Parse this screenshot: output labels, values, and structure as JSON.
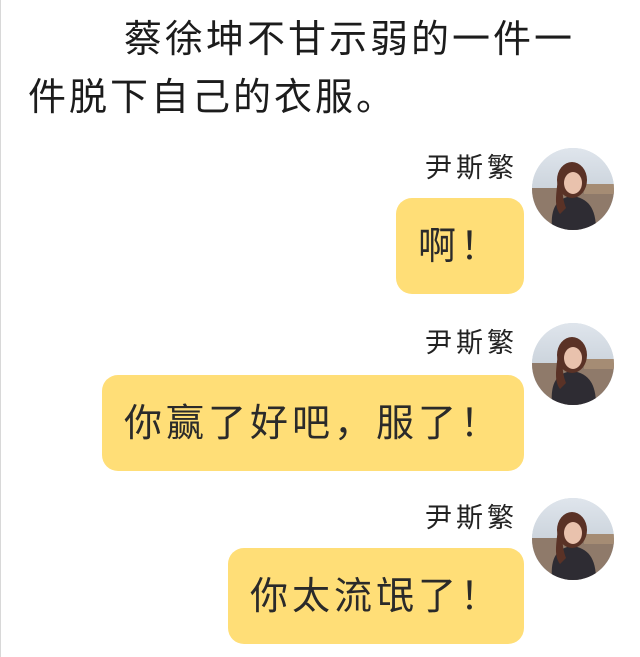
{
  "narration": "蔡徐坤不甘示弱的一件一件脱下自己的衣服。",
  "messages": [
    {
      "sender": "尹斯繁",
      "text": "啊！",
      "avatar": "girl-portrait-avatar"
    },
    {
      "sender": "尹斯繁",
      "text": "你赢了好吧，服了！",
      "avatar": "girl-portrait-avatar"
    },
    {
      "sender": "尹斯繁",
      "text": "你太流氓了！",
      "avatar": "girl-portrait-avatar"
    }
  ],
  "colors": {
    "bubble": "#ffde77",
    "background": "#ffffff",
    "text": "#1a1a1a"
  }
}
